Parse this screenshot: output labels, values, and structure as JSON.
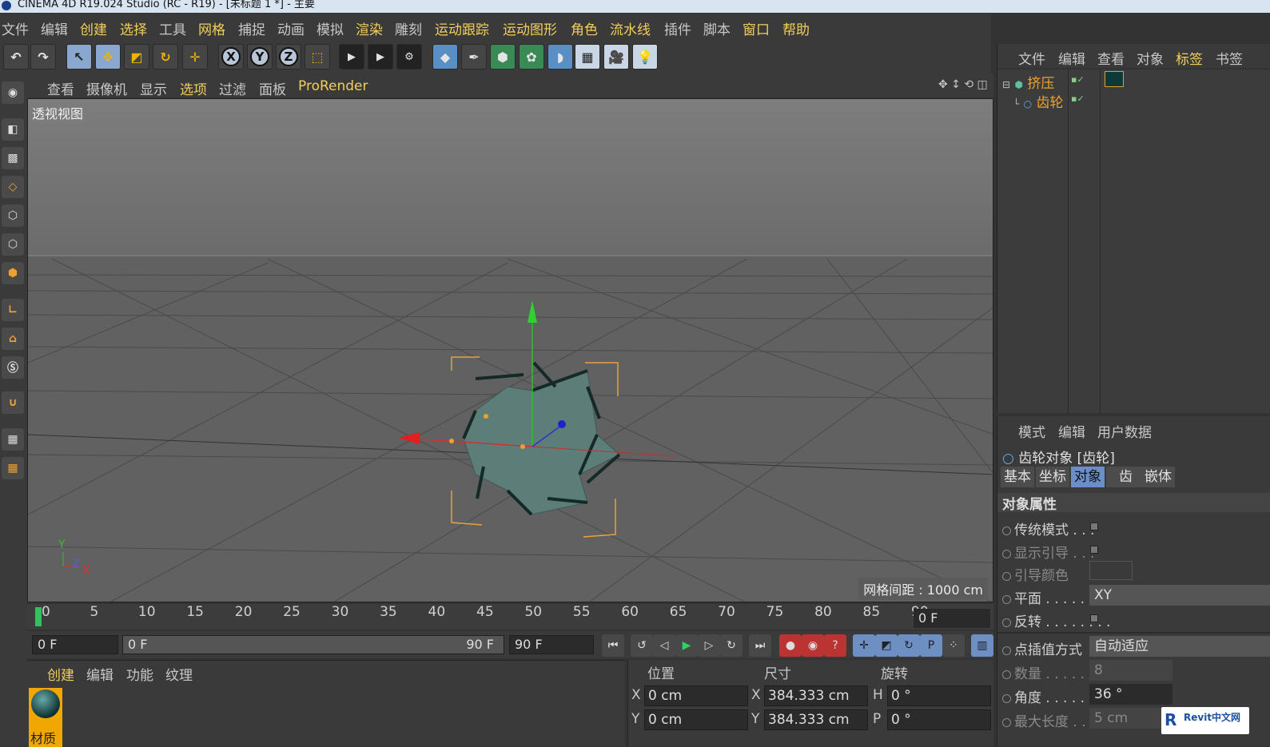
{
  "window": {
    "title": "CINEMA 4D R19.024 Studio (RC - R19) - [未标题 1 *] - 主要"
  },
  "menubar": {
    "items": [
      "文件",
      "编辑",
      "创建",
      "选择",
      "工具",
      "网格",
      "捕捉",
      "动画",
      "模拟",
      "渲染",
      "雕刻",
      "运动跟踪",
      "运动图形",
      "角色",
      "流水线",
      "插件",
      "脚本",
      "窗口",
      "帮助"
    ]
  },
  "toolbar": {
    "x_axis": "X",
    "y_axis": "Y",
    "z_axis": "Z"
  },
  "viewport": {
    "menu": [
      "查看",
      "摄像机",
      "显示",
      "选项",
      "过滤",
      "面板",
      "ProRender"
    ],
    "label": "透视视图",
    "grid_distance": "网格间距 : 1000 cm",
    "axis_x": "X",
    "axis_y": "Y",
    "axis_z": "Z"
  },
  "timeline": {
    "ticks": [
      "0",
      "5",
      "10",
      "15",
      "20",
      "25",
      "30",
      "35",
      "40",
      "45",
      "50",
      "55",
      "60",
      "65",
      "70",
      "75",
      "80",
      "85",
      "90"
    ],
    "current_frame": "0 F"
  },
  "playback": {
    "start": "0 F",
    "range_start": "0 F",
    "range_end": "90 F",
    "end": "90 F"
  },
  "material_panel": {
    "menu": [
      "创建",
      "编辑",
      "功能",
      "纹理"
    ],
    "material_name": "材质"
  },
  "coordinates": {
    "headers": [
      "位置",
      "尺寸",
      "旋转"
    ],
    "rows": [
      {
        "axis": "X",
        "pos": "0 cm",
        "size_axis": "X",
        "size": "384.333 cm",
        "rot_axis": "H",
        "rot": "0 °"
      },
      {
        "axis": "Y",
        "pos": "0 cm",
        "size_axis": "Y",
        "size": "384.333 cm",
        "rot_axis": "P",
        "rot": "0 °"
      }
    ]
  },
  "object_manager": {
    "menu": [
      "文件",
      "编辑",
      "查看",
      "对象",
      "标签",
      "书签"
    ],
    "objects": [
      {
        "name": "挤压"
      },
      {
        "name": "齿轮"
      }
    ]
  },
  "attributes": {
    "menu": [
      "模式",
      "编辑",
      "用户数据"
    ],
    "object_title": "齿轮对象 [齿轮]",
    "tabs": [
      "基本",
      "坐标",
      "对象",
      "齿",
      "嵌体"
    ],
    "section": "对象属性",
    "props": [
      {
        "label": "传统模式 . . ."
      },
      {
        "label": "显示引导 . . ."
      },
      {
        "label": "引导颜色"
      },
      {
        "label": "平面 . . . . . . . .",
        "value": "XY"
      },
      {
        "label": "反转 . . . . . . . ."
      },
      {
        "label": "点插值方式",
        "value": "自动适应"
      },
      {
        "label": "数量 . . . . . . . .",
        "value": "8"
      },
      {
        "label": "角度 . . . . . . . .",
        "value": "36 °"
      },
      {
        "label": "最大长度 . . .",
        "value": "5 cm"
      }
    ]
  },
  "watermark": {
    "text": "Revit中文网"
  }
}
